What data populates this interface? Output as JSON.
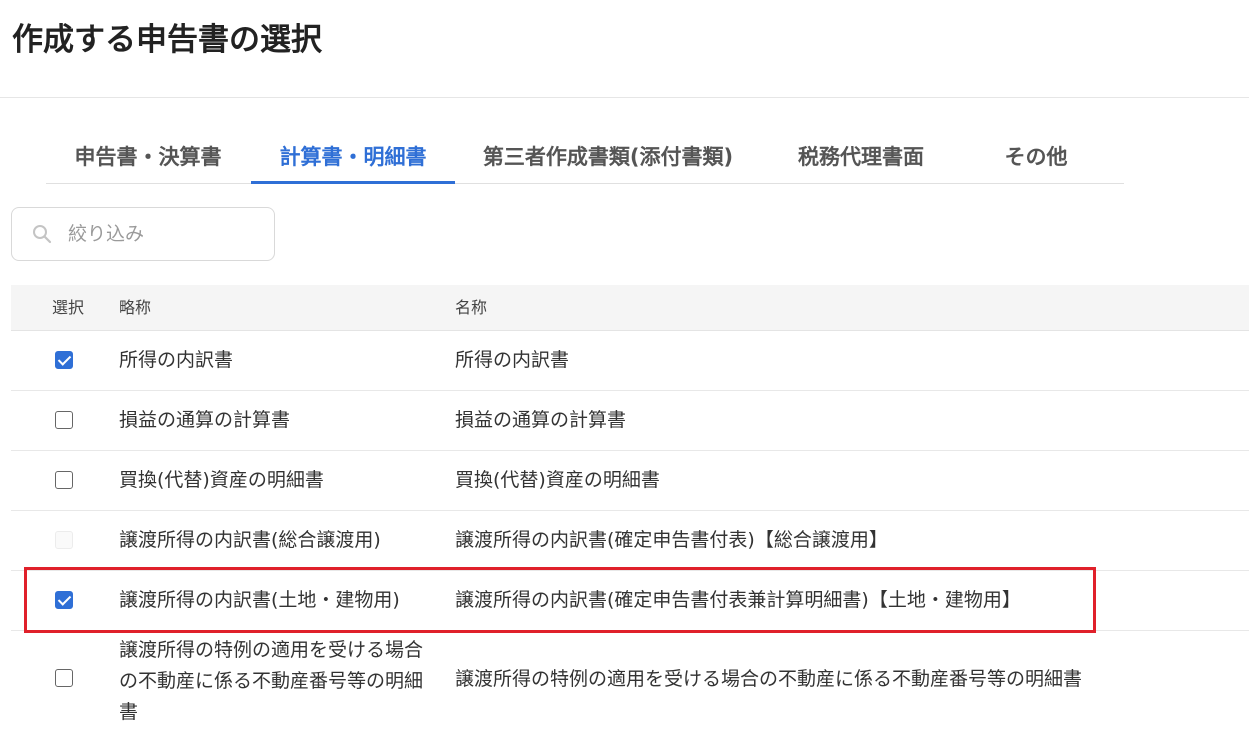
{
  "page": {
    "title": "作成する申告書の選択"
  },
  "tabs": [
    {
      "label": "申告書・決算書",
      "active": false
    },
    {
      "label": "計算書・明細書",
      "active": true
    },
    {
      "label": "第三者作成書類(添付書類)",
      "active": false
    },
    {
      "label": "税務代理書面",
      "active": false
    },
    {
      "label": "その他",
      "active": false
    }
  ],
  "search": {
    "placeholder": "絞り込み",
    "value": ""
  },
  "table": {
    "headers": {
      "select": "選択",
      "short_name": "略称",
      "name": "名称"
    },
    "rows": [
      {
        "checked": true,
        "disabled": false,
        "short_name": "所得の内訳書",
        "name": "所得の内訳書"
      },
      {
        "checked": false,
        "disabled": false,
        "short_name": "損益の通算の計算書",
        "name": "損益の通算の計算書"
      },
      {
        "checked": false,
        "disabled": false,
        "short_name": "買換(代替)資産の明細書",
        "name": "買換(代替)資産の明細書"
      },
      {
        "checked": false,
        "disabled": true,
        "short_name": "譲渡所得の内訳書(総合譲渡用)",
        "name": "譲渡所得の内訳書(確定申告書付表)【総合譲渡用】"
      },
      {
        "checked": true,
        "disabled": false,
        "short_name": "譲渡所得の内訳書(土地・建物用)",
        "name": "譲渡所得の内訳書(確定申告書付表兼計算明細書)【土地・建物用】"
      },
      {
        "checked": false,
        "disabled": false,
        "short_name": "譲渡所得の特例の適用を受ける場合の不動産に係る不動産番号等の明細書",
        "name": "譲渡所得の特例の適用を受ける場合の不動産に係る不動産番号等の明細書"
      }
    ]
  },
  "colors": {
    "accent": "#2f6fd6",
    "highlight": "#e0202a"
  }
}
